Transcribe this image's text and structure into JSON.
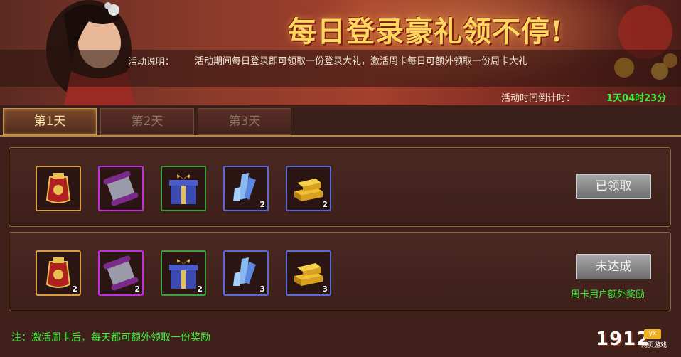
{
  "banner": {
    "title": "每日登录豪礼领不停!",
    "desc_label": "活动说明：",
    "desc_text": "活动期间每日登录即可领取一份登录大礼，激活周卡每日可额外领取一份周卡大礼",
    "countdown_label": "活动时间倒计时：",
    "countdown_value": "1天04时23分"
  },
  "tabs": [
    {
      "label": "第1天",
      "active": true
    },
    {
      "label": "第2天",
      "active": false
    },
    {
      "label": "第3天",
      "active": false
    }
  ],
  "rows": [
    {
      "items": [
        {
          "icon": "red-pouch-icon",
          "frame": "gold",
          "count": ""
        },
        {
          "icon": "scroll-icon",
          "frame": "purple",
          "count": ""
        },
        {
          "icon": "gift-box-icon",
          "frame": "green",
          "count": ""
        },
        {
          "icon": "blue-crystal-icon",
          "frame": "blue",
          "count": "2"
        },
        {
          "icon": "gold-bar-icon",
          "frame": "blue",
          "count": "2"
        }
      ],
      "button": "已领取",
      "extra": ""
    },
    {
      "items": [
        {
          "icon": "red-pouch-icon",
          "frame": "gold",
          "count": "2"
        },
        {
          "icon": "scroll-icon",
          "frame": "purple",
          "count": "2"
        },
        {
          "icon": "gift-box-icon",
          "frame": "green",
          "count": "2"
        },
        {
          "icon": "blue-crystal-icon",
          "frame": "blue",
          "count": "3"
        },
        {
          "icon": "gold-bar-icon",
          "frame": "blue",
          "count": "3"
        }
      ],
      "button": "未达成",
      "extra": "周卡用户额外奖励"
    }
  ],
  "footer": {
    "note": "注：激活周卡后，每天都可额外领取一份奖励",
    "logo": "1912",
    "logo_badge": "yx",
    "logo_sub": "网页游戏"
  },
  "colors": {
    "accent_green": "#3cf03c",
    "title_gold": "#ffd860",
    "frame_gold": "#d8a040",
    "frame_purple": "#c030e0",
    "frame_green": "#3ca040",
    "frame_blue": "#5a6ad8"
  }
}
